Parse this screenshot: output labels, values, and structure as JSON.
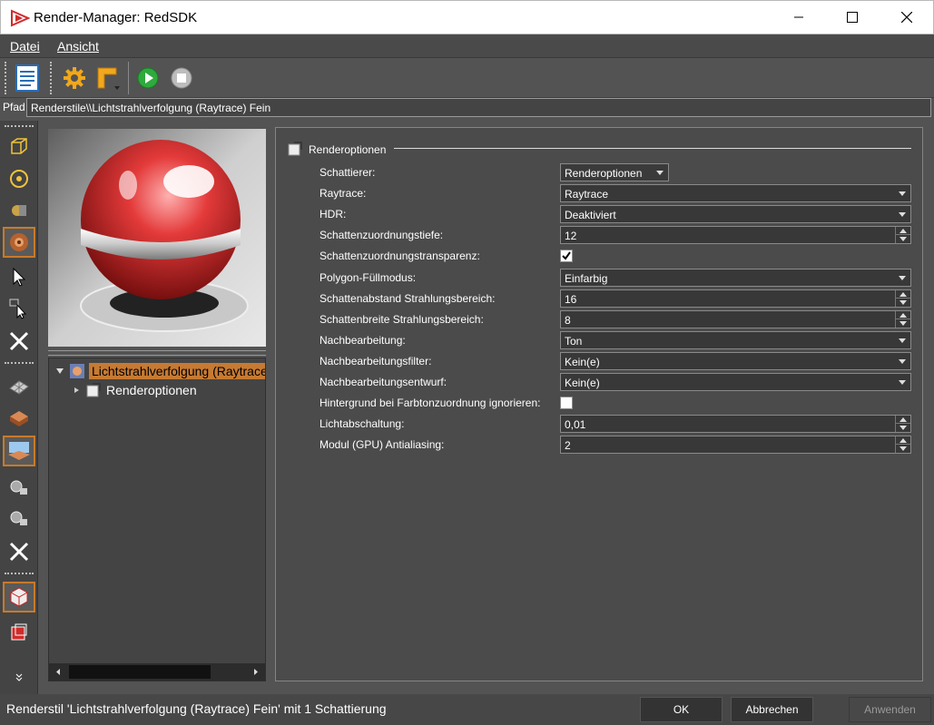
{
  "window": {
    "title": "Render-Manager: RedSDK",
    "controls": [
      "minimize-icon",
      "maximize-icon",
      "close-icon"
    ]
  },
  "menu": {
    "datei": "Datei",
    "ansicht": "Ansicht"
  },
  "path": {
    "label": "Pfad",
    "value": "Renderstile\\\\Lichtstrahlverfolgung (Raytrace) Fein"
  },
  "tree": {
    "root": "Lichtstrahlverfolgung (Raytrace) Fein",
    "child": "Renderoptionen"
  },
  "group": {
    "title": "Renderoptionen"
  },
  "options": [
    {
      "label": "Schattierer:",
      "value": "Renderoptionen",
      "type": "combo-small"
    },
    {
      "label": "Raytrace:",
      "value": "Raytrace",
      "type": "combo"
    },
    {
      "label": "HDR:",
      "value": "Deaktiviert",
      "type": "combo"
    },
    {
      "label": "Schattenzuordnungstiefe:",
      "value": "12",
      "type": "spin"
    },
    {
      "label": "Schattenzuordnungstransparenz:",
      "value": "true",
      "type": "check"
    },
    {
      "label": "Polygon-Füllmodus:",
      "value": "Einfarbig",
      "type": "combo"
    },
    {
      "label": "Schattenabstand Strahlungsbereich:",
      "value": "16",
      "type": "spin"
    },
    {
      "label": "Schattenbreite Strahlungsbereich:",
      "value": "8",
      "type": "spin"
    },
    {
      "label": "Nachbearbeitung:",
      "value": "Ton",
      "type": "combo"
    },
    {
      "label": "Nachbearbeitungsfilter:",
      "value": "Kein(e)",
      "type": "combo"
    },
    {
      "label": "Nachbearbeitungsentwurf:",
      "value": "Kein(e)",
      "type": "combo"
    },
    {
      "label": "Hintergrund bei Farbtonzuordnung ignorieren:",
      "value": "false",
      "type": "check"
    },
    {
      "label": "Lichtabschaltung:",
      "value": "0,01",
      "type": "spin"
    },
    {
      "label": "Modul (GPU) Antialiasing:",
      "value": "2",
      "type": "spin"
    }
  ],
  "status": {
    "text": "Renderstil 'Lichtstrahlverfolgung (Raytrace) Fein' mit 1 Schattierung"
  },
  "buttons": {
    "ok": "OK",
    "cancel": "Abbrechen",
    "apply": "Anwenden"
  },
  "colors": {
    "accent": "#c67a33",
    "background": "#535353"
  }
}
